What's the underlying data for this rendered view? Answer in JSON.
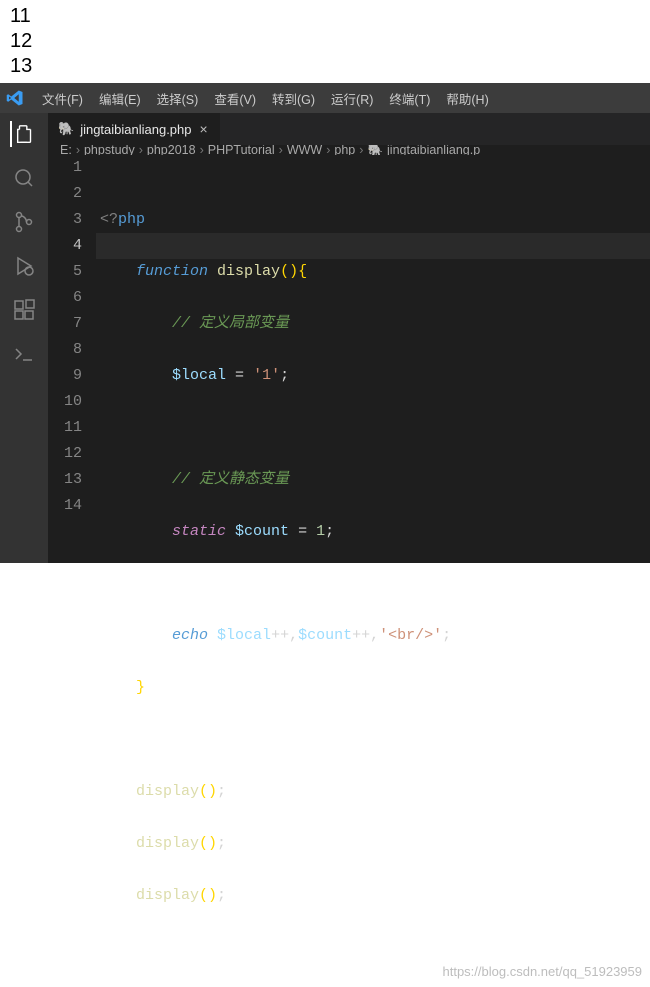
{
  "output": {
    "lines": [
      "11",
      "12",
      "13"
    ]
  },
  "menu": {
    "file": "文件(F)",
    "edit": "编辑(E)",
    "select": "选择(S)",
    "view": "查看(V)",
    "goto": "转到(G)",
    "run": "运行(R)",
    "terminal": "终端(T)",
    "help": "帮助(H)"
  },
  "tab": {
    "icon": "🐘",
    "label": "jingtaibianliang.php",
    "close": "×"
  },
  "breadcrumbs": {
    "sep": "›",
    "items": [
      "E:",
      "phpstudy",
      "php2018",
      "PHPTutorial",
      "WWW",
      "php",
      "jingtaibianliang.p"
    ],
    "lastIcon": "🐘"
  },
  "gutter": [
    "1",
    "2",
    "3",
    "4",
    "5",
    "6",
    "7",
    "8",
    "9",
    "10",
    "11",
    "12",
    "13",
    "14"
  ],
  "currentLine": 4,
  "code": {
    "php_open_q": "<?",
    "php_open_w": "php",
    "kw_function": "function",
    "fn_name": "display",
    "comment1": "// 定义局部变量",
    "var_local": "$local",
    "str_1": "'1'",
    "comment2": "// 定义静态变量",
    "kw_static": "static",
    "var_count": "$count",
    "num_1": "1",
    "kw_echo": "echo",
    "str_br": "'<br/>'",
    "call": "display"
  },
  "watermark": "https://blog.csdn.net/qq_51923959"
}
